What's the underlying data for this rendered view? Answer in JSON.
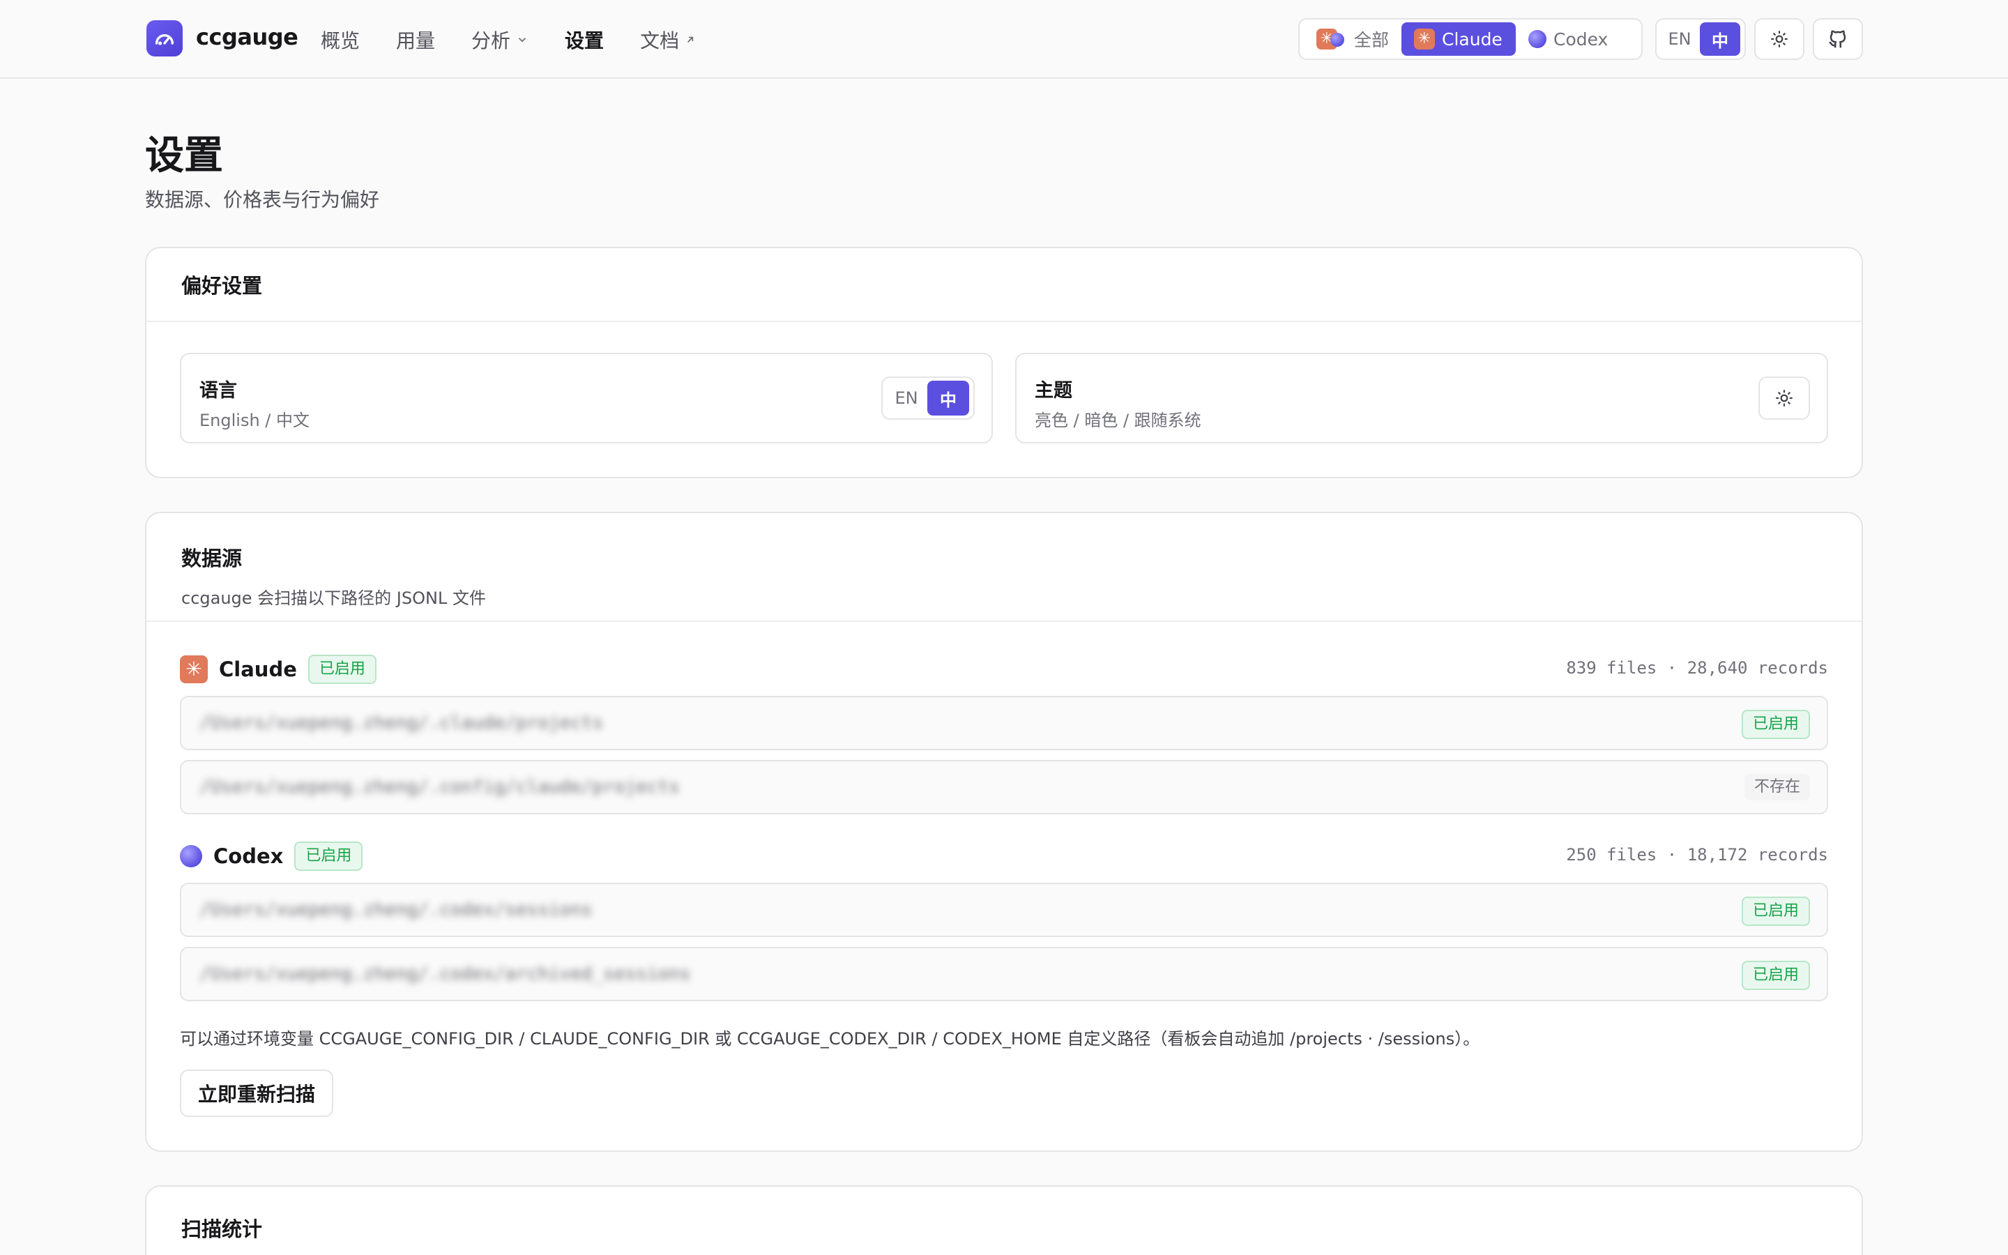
{
  "app": {
    "brand": "ccgauge"
  },
  "nav": {
    "overview": "概览",
    "usage": "用量",
    "analysis": "分析",
    "settings": "设置",
    "docs": "文档"
  },
  "source_switch": {
    "all": "全部",
    "claude": "Claude",
    "codex": "Codex",
    "active": "Claude"
  },
  "lang_switch": {
    "en": "EN",
    "zh": "中",
    "active": "中"
  },
  "page": {
    "title": "设置",
    "subtitle": "数据源、价格表与行为偏好"
  },
  "preferences": {
    "title": "偏好设置",
    "language": {
      "label": "语言",
      "hint": "English / 中文",
      "en": "EN",
      "zh": "中",
      "active": "中"
    },
    "theme": {
      "label": "主题",
      "hint": "亮色 / 暗色 / 跟随系统",
      "icon": "sun-icon"
    }
  },
  "datasource": {
    "title": "数据源",
    "desc": "ccgauge 会扫描以下路径的 JSONL 文件",
    "claude": {
      "name": "Claude",
      "status": "已启用",
      "stats": "839 files · 28,640 records",
      "paths": [
        {
          "path": "/Users/xuepeng.zheng/.claude/projects",
          "status": "已启用",
          "state": "on"
        },
        {
          "path": "/Users/xuepeng.zheng/.config/claude/projects",
          "status": "不存在",
          "state": "off"
        }
      ]
    },
    "codex": {
      "name": "Codex",
      "status": "已启用",
      "stats": "250 files · 18,172 records",
      "paths": [
        {
          "path": "/Users/xuepeng.zheng/.codex/sessions",
          "status": "已启用",
          "state": "on"
        },
        {
          "path": "/Users/xuepeng.zheng/.codex/archived_sessions",
          "status": "已启用",
          "state": "on"
        }
      ]
    },
    "note": "可以通过环境变量 CCGAUGE_CONFIG_DIR / CLAUDE_CONFIG_DIR 或 CCGAUGE_CODEX_DIR / CODEX_HOME 自定义路径（看板会自动追加 /projects · /sessions）。",
    "rescan": "立即重新扫描"
  },
  "scan_stats": {
    "title": "扫描统计"
  },
  "colors": {
    "accent": "#5b4fe0",
    "success": "#16a34a",
    "claude": "#e07a5a"
  }
}
